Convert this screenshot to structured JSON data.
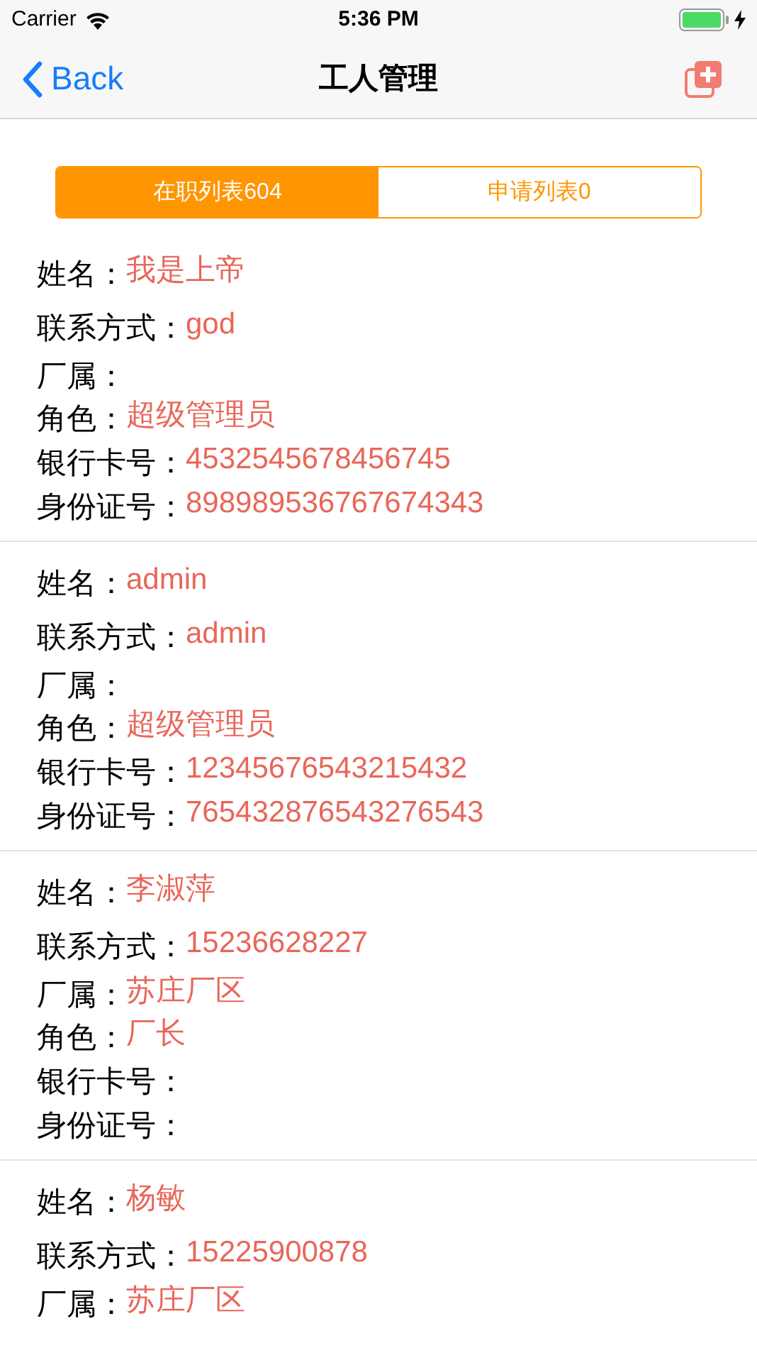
{
  "status_bar": {
    "carrier": "Carrier",
    "time": "5:36 PM"
  },
  "nav": {
    "back": "Back",
    "title": "工人管理"
  },
  "tabs": [
    {
      "label": "在职列表604",
      "selected": true
    },
    {
      "label": "申请列表0",
      "selected": false
    }
  ],
  "workers": [
    {
      "fields": [
        {
          "label": "姓名：",
          "value": "我是上帝"
        },
        {
          "label": "联系方式：",
          "value": "god"
        },
        {
          "label": "厂属："
        },
        {
          "label": "角色：",
          "value": "超级管理员"
        },
        {
          "label": "银行卡号：",
          "value": "4532545678456745"
        },
        {
          "label": "身份证号：",
          "value": "898989536767674343"
        }
      ]
    },
    {
      "fields": [
        {
          "label": "姓名：",
          "value": "admin"
        },
        {
          "label": "联系方式：",
          "value": "admin"
        },
        {
          "label": "厂属："
        },
        {
          "label": "角色：",
          "value": "超级管理员"
        },
        {
          "label": "银行卡号：",
          "value": "12345676543215432"
        },
        {
          "label": "身份证号：",
          "value": "765432876543276543"
        }
      ]
    },
    {
      "fields": [
        {
          "label": "姓名：",
          "value": "李淑萍"
        },
        {
          "label": "联系方式：",
          "value": "15236628227"
        },
        {
          "label": "厂属：",
          "value": "苏庄厂区"
        },
        {
          "label": "角色：",
          "value": "厂长"
        },
        {
          "label": "银行卡号："
        },
        {
          "label": "身份证号："
        }
      ]
    },
    {
      "fields": [
        {
          "label": "姓名：",
          "value": "杨敏"
        },
        {
          "label": "联系方式：",
          "value": "15225900878"
        },
        {
          "label": "厂属：",
          "value": "苏庄厂区"
        }
      ]
    }
  ]
}
